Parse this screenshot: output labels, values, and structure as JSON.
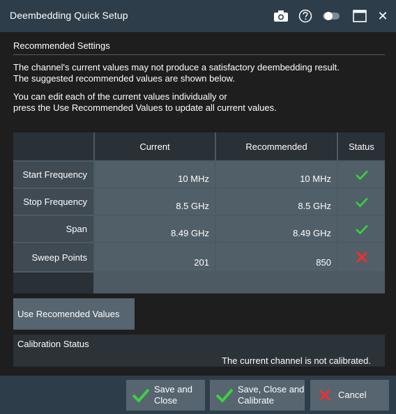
{
  "window": {
    "title": "Deembedding Quick Setup",
    "icons": [
      "camera-icon",
      "help-icon",
      "toggle-icon",
      "maximize-icon",
      "close-icon"
    ],
    "close_glyph": "✕"
  },
  "section": {
    "title": "Recommended Settings"
  },
  "paragraphs": {
    "p1": "The channel's current values may not produce a satisfactory deembedding result.",
    "p2": "The suggested recommended values are shown below.",
    "p3": "You can edit each of the current values individually or",
    "p4": "press the Use Recommended Values to update all current values."
  },
  "table": {
    "columns": [
      "Current",
      "Recommended",
      "Status"
    ],
    "rows": [
      {
        "label": "Start Frequency",
        "current": "10 MHz",
        "recommended": "10 MHz",
        "status": "ok"
      },
      {
        "label": "Stop Frequency",
        "current": "8.5 GHz",
        "recommended": "8.5 GHz",
        "status": "ok"
      },
      {
        "label": "Span",
        "current": "8.49 GHz",
        "recommended": "8.49 GHz",
        "status": "ok"
      },
      {
        "label": "Sweep Points",
        "current": "201",
        "recommended": "850",
        "status": "error"
      }
    ]
  },
  "use_recommended_button": "Use Recomended Values",
  "calibration": {
    "title": "Calibration Status",
    "message": "The current channel is not calibrated."
  },
  "footer": {
    "save_close": "Save and\nClose",
    "save_close_calibrate": "Save, Close and\nCalibrate",
    "cancel": "Cancel"
  },
  "colors": {
    "ok": "#3bd23d",
    "error": "#ff2a2a",
    "titlebar": "#2d3d4a",
    "button": "#566570"
  }
}
